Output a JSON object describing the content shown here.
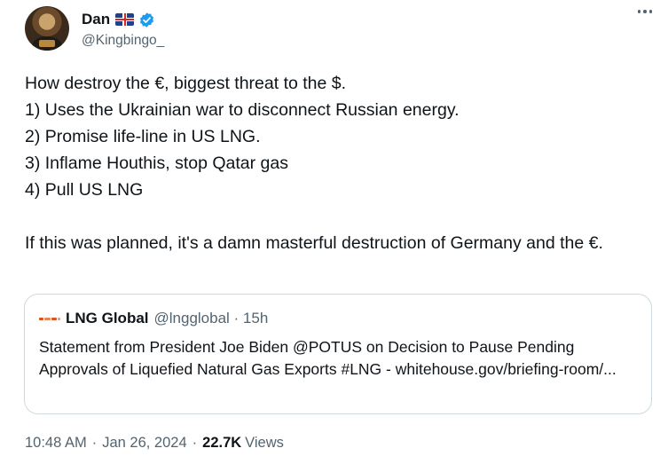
{
  "author": {
    "display_name": "Dan",
    "flag_icon": "uk-flag-icon",
    "verified_icon": "verified-badge-icon",
    "verified_color": "#1d9bf0",
    "handle": "@Kingbingo_"
  },
  "more_icon": "more-options-icon",
  "post": {
    "lines": [
      "How destroy the €, biggest threat to the $.",
      "1) Uses the Ukrainian war to disconnect Russian energy.",
      "2) Promise life-line in US LNG.",
      "3) Inflame Houthis, stop Qatar gas",
      "4) Pull US LNG"
    ],
    "conclusion": "If this was planned, it's a damn masterful destruction of Germany and the €."
  },
  "quoted_post": {
    "logo_icon": "lng-global-logo-icon",
    "name": "LNG Global",
    "handle_time": "@lngglobal · 15h",
    "text": "Statement from President Joe Biden @POTUS on Decision to Pause Pending Approvals of Liquefied Natural Gas Exports #LNG - whitehouse.gov/briefing-room/..."
  },
  "meta": {
    "time": "10:48 AM",
    "separator": "·",
    "date": "Jan 26, 2024",
    "views_count": "22.7K",
    "views_label": "Views"
  }
}
